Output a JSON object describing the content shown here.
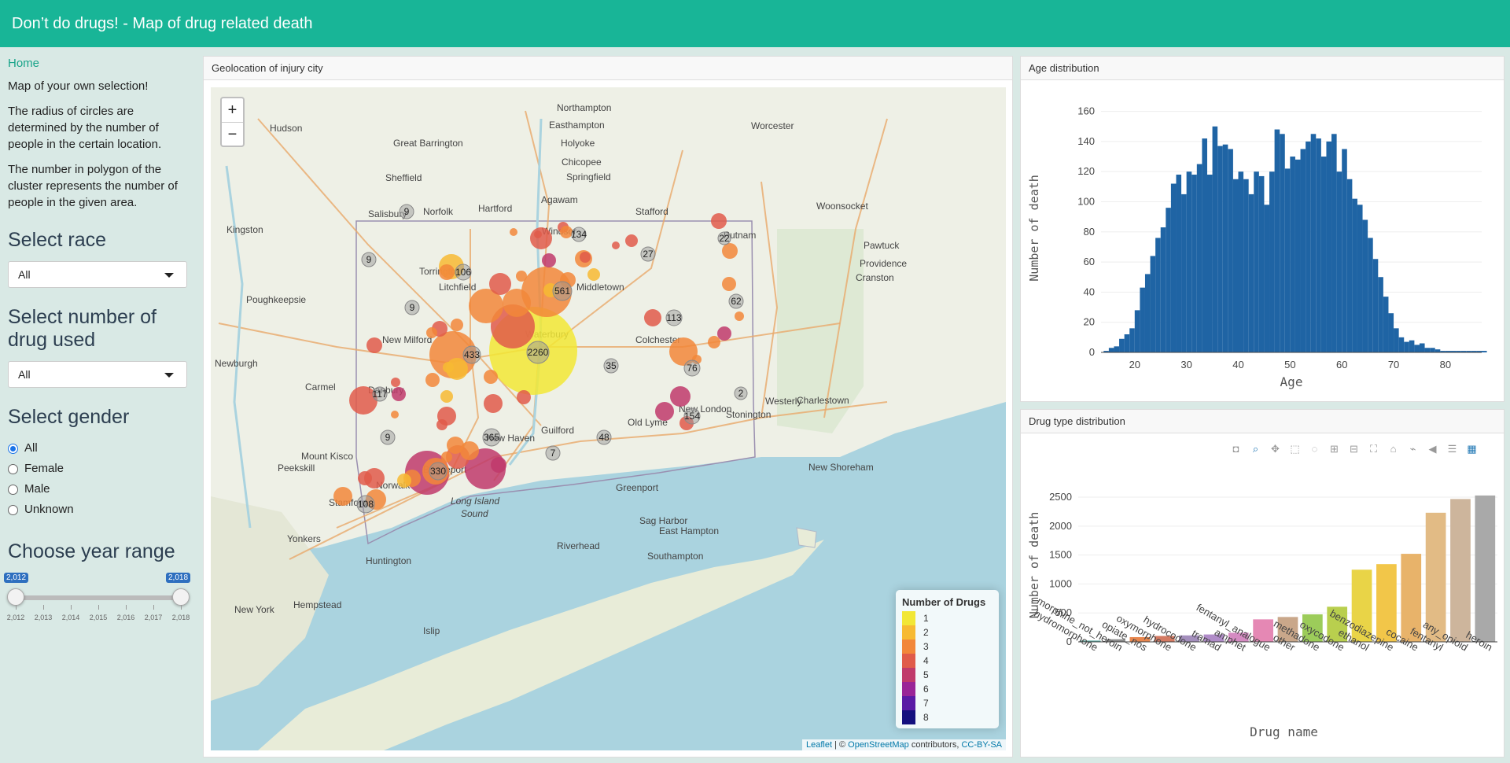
{
  "app": {
    "title": "Don’t do drugs! - Map of drug related death"
  },
  "sidebar": {
    "home": "Home",
    "intro": "Map of your own selection!",
    "para1": "The radius of circles are determined by the number of people in the certain location.",
    "para2": "The number in polygon of the cluster represents the number of people in the given area.",
    "race_title": "Select race",
    "race_value": "All",
    "drugnum_title": "Select number of drug used",
    "drugnum_value": "All",
    "gender_title": "Select gender",
    "gender_options": [
      "All",
      "Female",
      "Male",
      "Unknown"
    ],
    "gender_selected": "All",
    "year_title": "Choose year range",
    "year_min_label": "2,012",
    "year_max_label": "2,018",
    "year_ticks": [
      "2,012",
      "2,013",
      "2,014",
      "2,015",
      "2,016",
      "2,017",
      "2,018"
    ],
    "year_range": [
      2012,
      2018
    ]
  },
  "map": {
    "title": "Geolocation of injury city",
    "zoom_in": "+",
    "zoom_out": "−",
    "legend_title": "Number of Drugs",
    "legend": [
      {
        "label": "1",
        "color": "#f2e735"
      },
      {
        "label": "2",
        "color": "#f7ba32"
      },
      {
        "label": "3",
        "color": "#f2873a"
      },
      {
        "label": "4",
        "color": "#e05b4a"
      },
      {
        "label": "5",
        "color": "#c03a6b"
      },
      {
        "label": "6",
        "color": "#9a2497"
      },
      {
        "label": "7",
        "color": "#5a1aa5"
      },
      {
        "label": "8",
        "color": "#14107e"
      }
    ],
    "attribution_leaflet": "Leaflet",
    "attribution_sep": " | © ",
    "attribution_osm": "OpenStreetMap",
    "attribution_mid": " contributors, ",
    "attribution_cc": "CC-BY-SA",
    "sound_label_1": "Long Island",
    "sound_label_2": "Sound",
    "cluster_counts": [
      "2260",
      "561",
      "433",
      "365",
      "330",
      "134",
      "117",
      "113",
      "108",
      "106",
      "76",
      "62",
      "154",
      "48",
      "35",
      "27",
      "22",
      "9",
      "9",
      "9",
      "9",
      "7",
      "2"
    ],
    "places": [
      "Northampton",
      "Easthampton",
      "Holyoke",
      "Chicopee",
      "Springfield",
      "Worcester",
      "Agawam",
      "Great Barrington",
      "Sheffield",
      "Salisbury",
      "Norfolk",
      "Hartford",
      "Windsor",
      "Stafford",
      "Putnam",
      "Woonsocket",
      "Pawtuck",
      "Providence",
      "Cranston",
      "Torrington",
      "Litchfield",
      "Waterbury",
      "Middletown",
      "Colchester",
      "New Milford",
      "Danbury",
      "Norwalk",
      "Stamford",
      "Bridgeport",
      "New Haven",
      "Guilford",
      "Old Lyme",
      "New London",
      "Stonington",
      "Westerly",
      "Charlestown",
      "New Shoreham",
      "Riverhead",
      "Southampton",
      "East Hampton",
      "Greenport",
      "Sag Harbor",
      "Huntington",
      "Islip",
      "Yonkers",
      "New York",
      "Hempstead",
      "Poughkeepsie",
      "Newburgh",
      "Kingston",
      "Hudson",
      "Carmel",
      "Peekskill",
      "Mount Kisco"
    ]
  },
  "age_chart": {
    "title": "Age distribution",
    "chart_data": {
      "type": "bar",
      "xlabel": "Age",
      "ylabel": "Number of death",
      "xlim": [
        13.5,
        87
      ],
      "ylim": [
        0,
        165
      ],
      "x_ticks": [
        "20",
        "30",
        "40",
        "50",
        "60",
        "70",
        "80"
      ],
      "y_ticks": [
        "0",
        "20",
        "40",
        "60",
        "80",
        "100",
        "120",
        "140",
        "160"
      ],
      "bin_start": 14,
      "bin_width": 1,
      "values": [
        1,
        3,
        4,
        9,
        12,
        16,
        28,
        43,
        52,
        64,
        76,
        83,
        96,
        112,
        118,
        105,
        120,
        118,
        125,
        142,
        118,
        150,
        137,
        138,
        135,
        115,
        120,
        115,
        105,
        120,
        117,
        98,
        120,
        148,
        145,
        122,
        130,
        128,
        135,
        140,
        145,
        142,
        130,
        140,
        145,
        120,
        135,
        115,
        102,
        98,
        88,
        76,
        62,
        50,
        37,
        26,
        16,
        10,
        7,
        8,
        5,
        6,
        3,
        3,
        2,
        1,
        1,
        1,
        1,
        1,
        1,
        1,
        1,
        1
      ]
    }
  },
  "drug_chart": {
    "title": "Drug type distribution",
    "modebar": [
      "camera-icon",
      "zoom-icon",
      "pan-icon",
      "box-select-icon",
      "lasso-icon",
      "zoom-in-icon",
      "zoom-out-icon",
      "autoscale-icon",
      "home-icon",
      "spike-icon",
      "hover-closest-icon",
      "hover-compare-icon",
      "plotly-logo-icon"
    ],
    "chart_data": {
      "type": "bar",
      "xlabel": "Drug name",
      "ylabel": "Number of death",
      "ylim": [
        0,
        2650
      ],
      "y_ticks": [
        "0",
        "500",
        "1000",
        "1500",
        "2000",
        "2500"
      ],
      "categories": [
        "hydromorphone",
        "morphine_not_heroin",
        "opiate_nos",
        "oxymorphone",
        "hydrocodone",
        "tramad",
        "amphet",
        "fentanyl_analogue",
        "other",
        "methadone",
        "oxycodone",
        "ethanol",
        "benzodiazepine",
        "cocaine",
        "fentanyl",
        "any_opioid",
        "heroin"
      ],
      "values": [
        22,
        45,
        82,
        102,
        112,
        128,
        158,
        389,
        430,
        475,
        607,
        1247,
        1343,
        1521,
        2231,
        2468,
        2529
      ],
      "colors": [
        "#5aa99f",
        "#8c8c8c",
        "#e8864e",
        "#d47a62",
        "#a48fbd",
        "#b08cc8",
        "#d58bc2",
        "#e588b4",
        "#c9a78a",
        "#9ccc5a",
        "#b9cf4e",
        "#e9d447",
        "#f2c649",
        "#e8b36a",
        "#e2bb85",
        "#cdb59c",
        "#a9a9a9"
      ]
    }
  }
}
